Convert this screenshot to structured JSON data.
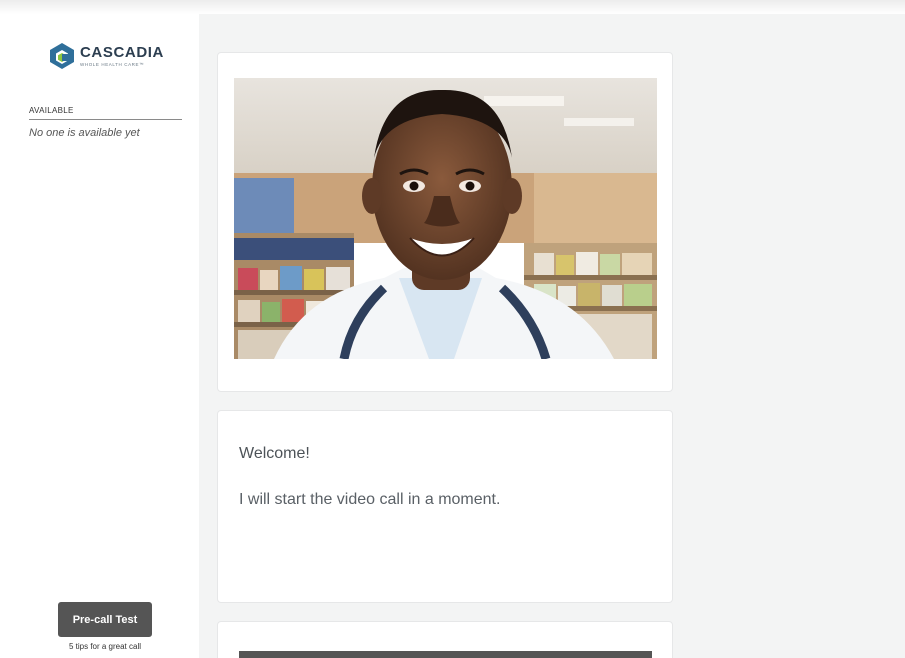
{
  "sidebar": {
    "logo": {
      "name": "CASCADIA",
      "tagline": "WHOLE HEALTH CARE™",
      "mark_color": "#2f6f9a",
      "mark_accent": "#8dc63f"
    },
    "available_heading": "AVAILABLE",
    "available_empty": "No one is available yet",
    "precall_button": "Pre-call Test",
    "tips_link": "5 tips for a great call"
  },
  "main": {
    "welcome_title": "Welcome!",
    "welcome_message": "I will start the video call in a moment."
  },
  "colors": {
    "main_bg": "#f3f4f4",
    "button_bg": "#555555",
    "text": "#4d5358"
  }
}
